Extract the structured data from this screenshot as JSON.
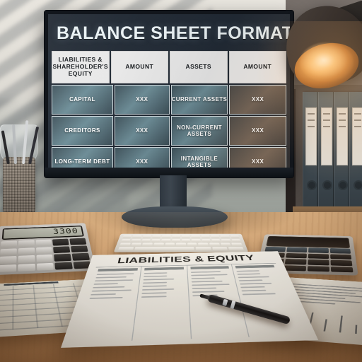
{
  "scene": {
    "description": "office-desk-with-monitor-showing-balance-sheet-format",
    "colors": {
      "slide_header_bg": "#1c2430",
      "slide_header_text": "#e9f1f4",
      "table_header_bg": "#e8e8e8",
      "table_header_text": "#14181c",
      "table_cell_bg": "#6d8d97",
      "table_cell_text": "#ffffff",
      "desk_wood": "#d6a776",
      "wall": "#dedbd4",
      "lamp_glow": "#ffd696",
      "binder": "#414c53"
    }
  },
  "monitor": {
    "slide": {
      "title": "BALANCE SHEET FORMAT",
      "table": {
        "headers": [
          "LIABILITIES & SHAREHOLDER'S EQUITY",
          "AMOUNT",
          "ASSETS",
          "AMOUNT"
        ],
        "rows": [
          [
            "CAPITAL",
            "XXX",
            "CURRENT ASSETS",
            "XXX"
          ],
          [
            "CREDITORS",
            "XXX",
            "NON-CURRENT ASSETS",
            "XXX"
          ],
          [
            "LONG-TERM DEBT",
            "XXX",
            "INTANGIBLE ASSETS",
            "XXX"
          ]
        ]
      }
    }
  },
  "desk": {
    "calculator_left": {
      "display_value": "3300"
    },
    "paper_main": {
      "heading": "LIABILITIES & EQUITY"
    }
  }
}
